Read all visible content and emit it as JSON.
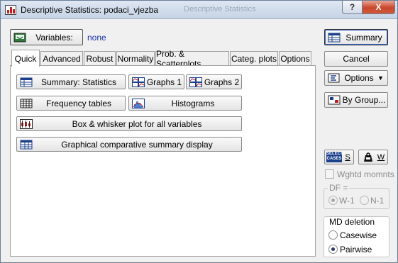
{
  "window": {
    "title": "Descriptive Statistics: podaci_vjezba",
    "background_title": "Descriptive Statistics",
    "help_label": "?",
    "close_label": "X"
  },
  "variables": {
    "button_label": "Variables:",
    "value": "none"
  },
  "tabs": [
    {
      "label": "Quick",
      "active": true
    },
    {
      "label": "Advanced"
    },
    {
      "label": "Robust"
    },
    {
      "label": "Normality"
    },
    {
      "label": "Prob. & Scatterplots"
    },
    {
      "label": "Categ. plots"
    },
    {
      "label": "Options"
    }
  ],
  "quick": {
    "summary_statistics": "Summary: Statistics",
    "graphs1": "Graphs 1",
    "graphs2": "Graphs 2",
    "frequency_tables": "Frequency tables",
    "histograms": "Histograms",
    "box_whisker": "Box & whisker plot for all variables",
    "graphical_summary": "Graphical comparative summary display"
  },
  "side": {
    "summary": "Summary",
    "cancel": "Cancel",
    "options": "Options",
    "by_group": "By Group...",
    "select_cases_icon_text": "SELECT CASES",
    "select_cases_shortcut": "S",
    "weight_shortcut": "W",
    "wghtd_momnts": "Wghtd momnts",
    "df_label": "DF =",
    "df_options": [
      "W-1",
      "N-1"
    ],
    "df_selected": "W-1",
    "md_deletion_label": "MD deletion",
    "md_options": [
      "Casewise",
      "Pairwise"
    ],
    "md_selected": "Pairwise"
  },
  "colors": {
    "link_blue": "#1a33a8",
    "close_red": "#c9472c",
    "panel_white": "#ffffff",
    "dialog_gray": "#f0f0f0"
  }
}
